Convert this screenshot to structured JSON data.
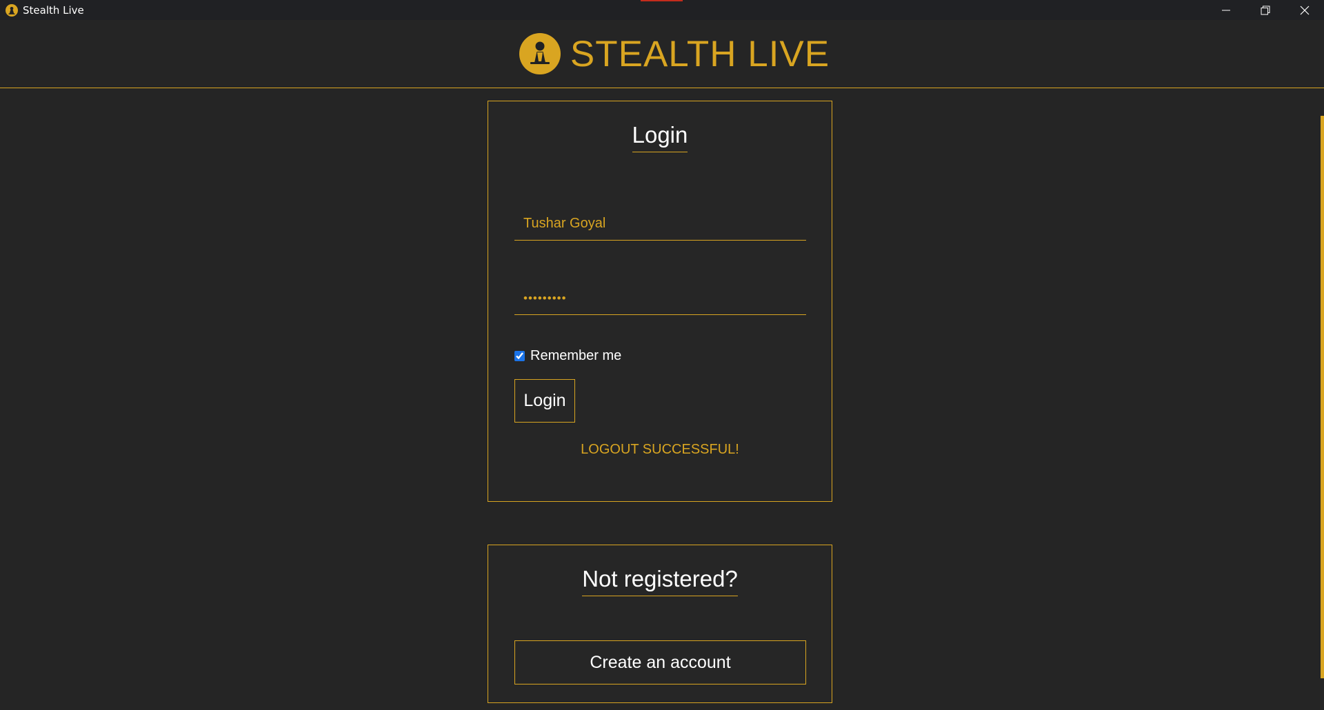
{
  "window": {
    "title": "Stealth Live",
    "controls": {
      "minimize_icon": "minimize-icon",
      "restore_icon": "restore-icon",
      "close_icon": "close-icon"
    }
  },
  "header": {
    "brand_name": "STEALTH LIVE",
    "logo_icon": "user-badge-icon"
  },
  "login": {
    "heading": "Login",
    "username_value": "Tushar Goyal",
    "password_value": "•••••••••",
    "remember_label": "Remember me",
    "remember_checked": true,
    "button_label": "Login",
    "status_message": "LOGOUT SUCCESSFUL!"
  },
  "register": {
    "heading": "Not registered?",
    "button_label": "Create an account"
  },
  "colors": {
    "accent": "#d9a521",
    "background": "#252525",
    "titlebar": "#202124",
    "text": "#ffffff",
    "titlebar_accent": "#c42b1c"
  }
}
